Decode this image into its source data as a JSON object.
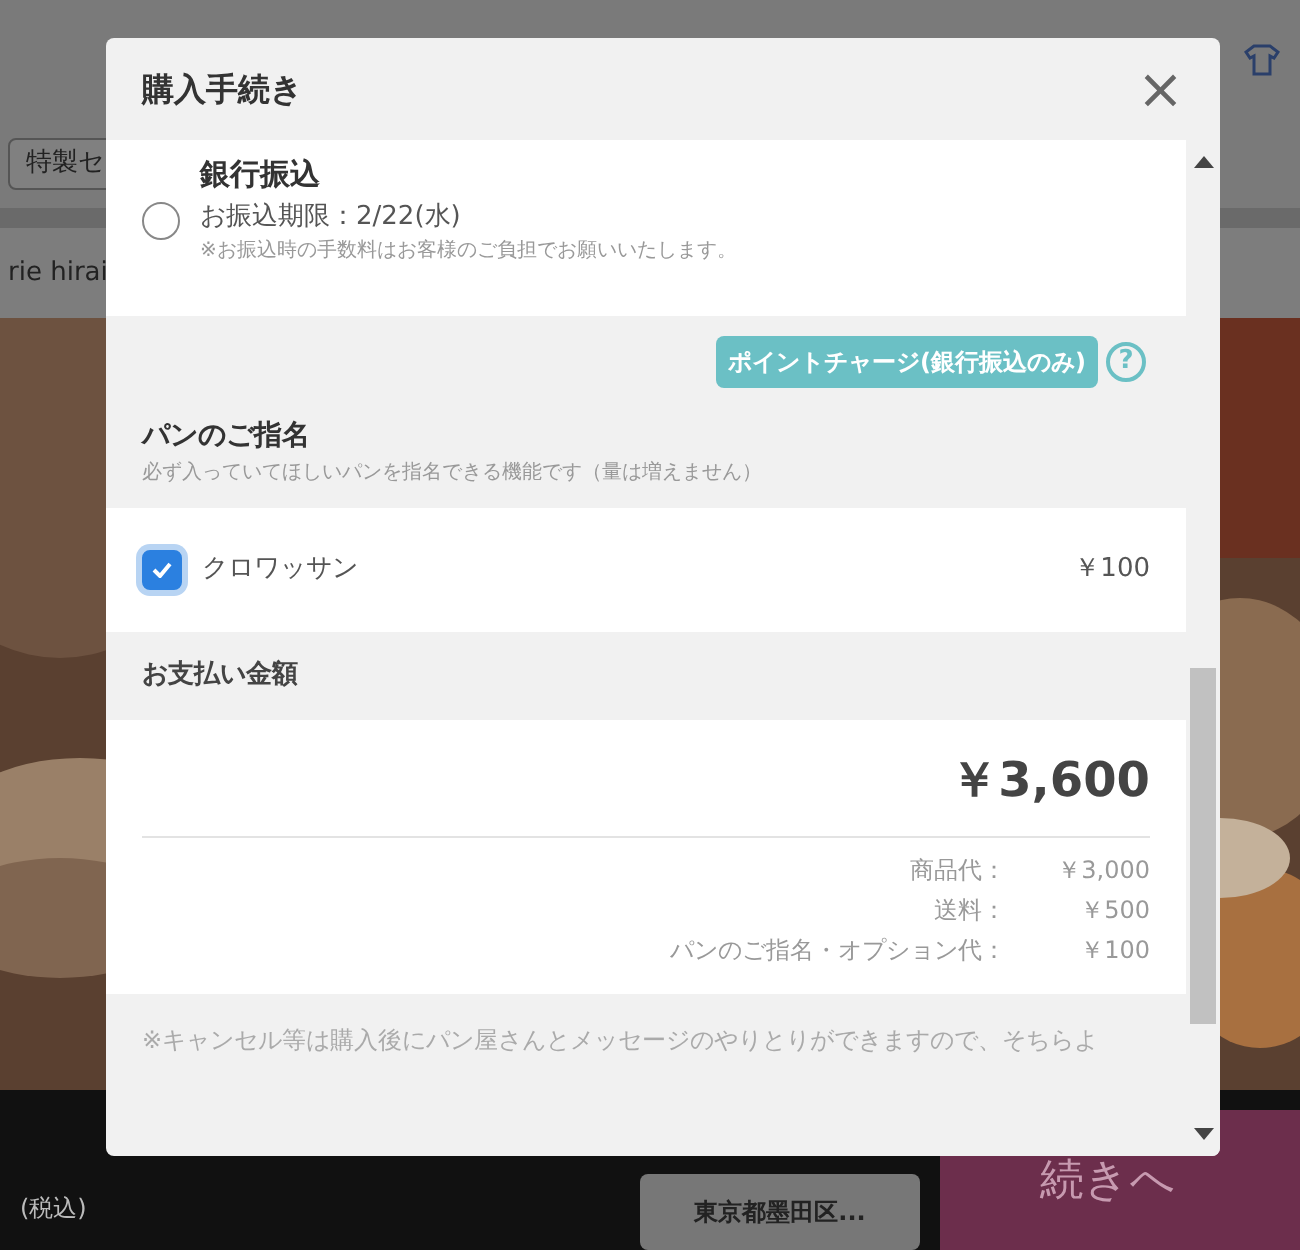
{
  "background": {
    "chip": "特製セ",
    "shop_name": "rie hirai",
    "tax_note": "(税込)",
    "area_button": "東京都墨田区...",
    "next_button": "続きへ"
  },
  "modal": {
    "title": "購入手続き",
    "close": "×",
    "payment_option": {
      "label": "銀行振込",
      "deadline": "お振込期限：2/22(水)",
      "note": "※お振込時の手数料はお客様のご負担でお願いいたします。",
      "selected": false
    },
    "point_charge_button": "ポイントチャージ(銀行振込のみ)",
    "help": "?",
    "nomination": {
      "title": "パンのご指名",
      "description": "必ず入っていてほしいパンを指名できる機能です（量は増えません）",
      "items": [
        {
          "name": "クロワッサン",
          "price": "￥100",
          "checked": true
        }
      ]
    },
    "payment": {
      "title": "お支払い金額",
      "total": "￥3,600",
      "breakdown": [
        {
          "label": "商品代：",
          "value": "￥3,000"
        },
        {
          "label": "送料：",
          "value": "￥500"
        },
        {
          "label": "パンのご指名・オプション代：",
          "value": "￥100"
        }
      ]
    },
    "footer_note": "※キャンセル等は購入後にパン屋さんとメッセージのやりとりができますので、そちらよ",
    "scrollbar": {
      "level": 0.35
    }
  }
}
